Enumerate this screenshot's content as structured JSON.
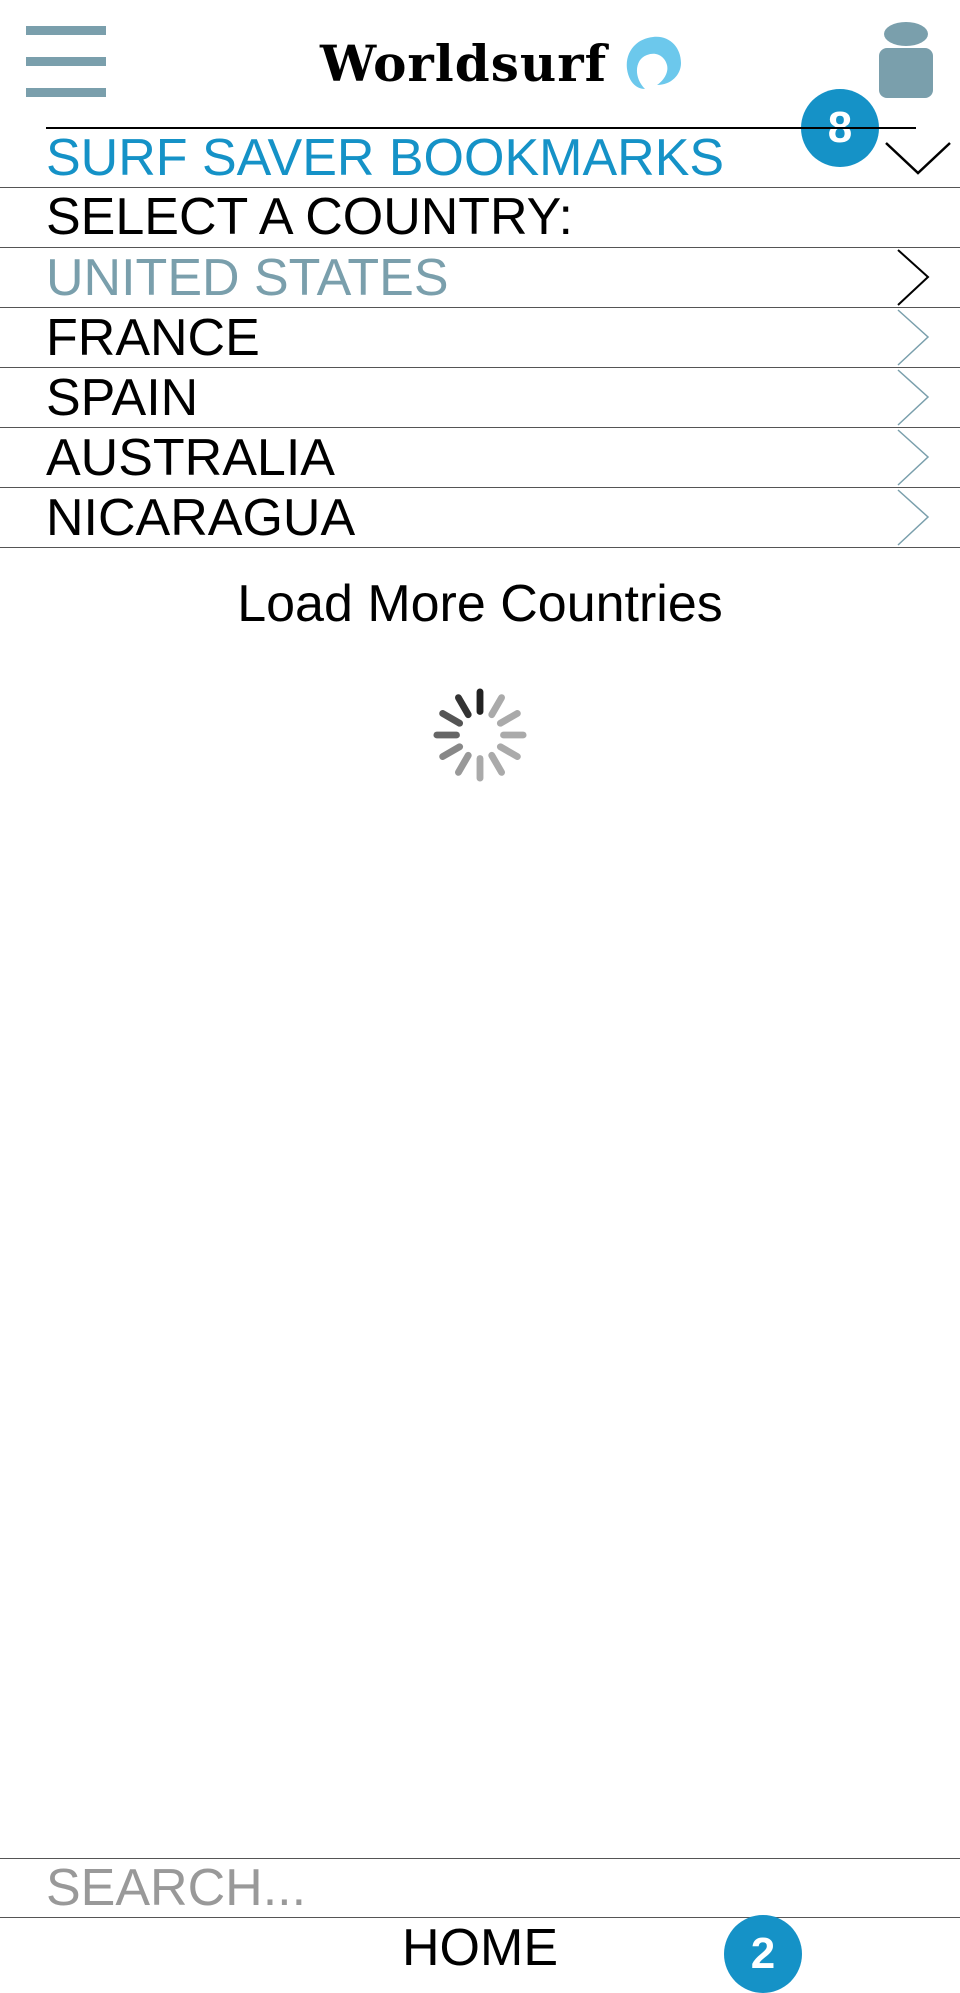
{
  "header": {
    "logo_text": "Worldsurf",
    "menu_icon": "hamburger-menu-icon",
    "account_icon": "user-account-icon",
    "notification_count": "8",
    "brand_color": "#1592c7",
    "accent_color": "#7a9fac"
  },
  "bookmarks": {
    "label": "SURF SAVER BOOKMARKS",
    "icon": "chevron-down-icon"
  },
  "countries": {
    "select_label": "SELECT A COUNTRY:",
    "items": [
      {
        "name": "UNITED STATES",
        "selected": true
      },
      {
        "name": "FRANCE",
        "selected": false
      },
      {
        "name": "SPAIN",
        "selected": false
      },
      {
        "name": "AUSTRALIA",
        "selected": false
      },
      {
        "name": "NICARAGUA",
        "selected": false
      }
    ],
    "load_more_label": "Load More Countries",
    "loading_icon": "loading-spinner-icon"
  },
  "footer": {
    "search_placeholder": "SEARCH...",
    "home_label": "HOME",
    "home_badge_count": "2"
  }
}
